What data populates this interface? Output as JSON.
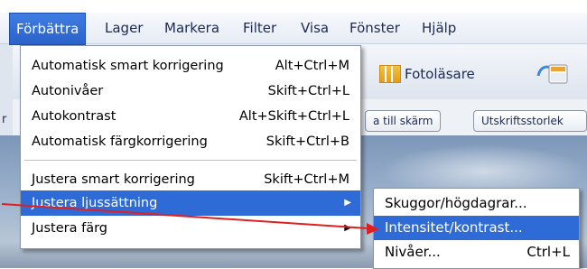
{
  "menubar": {
    "items": [
      "Förbättra",
      "Lager",
      "Markera",
      "Filter",
      "Visa",
      "Fönster",
      "Hjälp"
    ],
    "active": "Förbättra"
  },
  "background": {
    "fotolasare": "Fotoläsare",
    "btn_fit": "a till skärm",
    "btn_print": "Utskriftsstorlek",
    "sliver_char": "r"
  },
  "menu": {
    "items": [
      {
        "label": "Automatisk smart korrigering",
        "shortcut": "Alt+Ctrl+M"
      },
      {
        "label": "Autonivåer",
        "shortcut": "Skift+Ctrl+L"
      },
      {
        "label": "Autokontrast",
        "shortcut": "Alt+Skift+Ctrl+L"
      },
      {
        "label": "Automatisk färgkorrigering",
        "shortcut": "Skift+Ctrl+B"
      },
      {
        "label": "Justera smart korrigering",
        "shortcut": "Skift+Ctrl+M"
      },
      {
        "label": "Justera ljussättning",
        "shortcut": ""
      },
      {
        "label": "Justera färg",
        "shortcut": ""
      }
    ]
  },
  "submenu": {
    "items": [
      {
        "label": "Skuggor/högdagrar...",
        "shortcut": ""
      },
      {
        "label": "Intensitet/kontrast...",
        "shortcut": ""
      },
      {
        "label": "Nivåer...",
        "shortcut": "Ctrl+L"
      }
    ]
  },
  "colors": {
    "highlight": "#2f6bd6",
    "annotation_arrow": "#e02020"
  },
  "icons": {
    "grid": "grid-icon",
    "photo": "photo-viewer-icon",
    "submenu_arrow": "triangle-right-icon"
  }
}
